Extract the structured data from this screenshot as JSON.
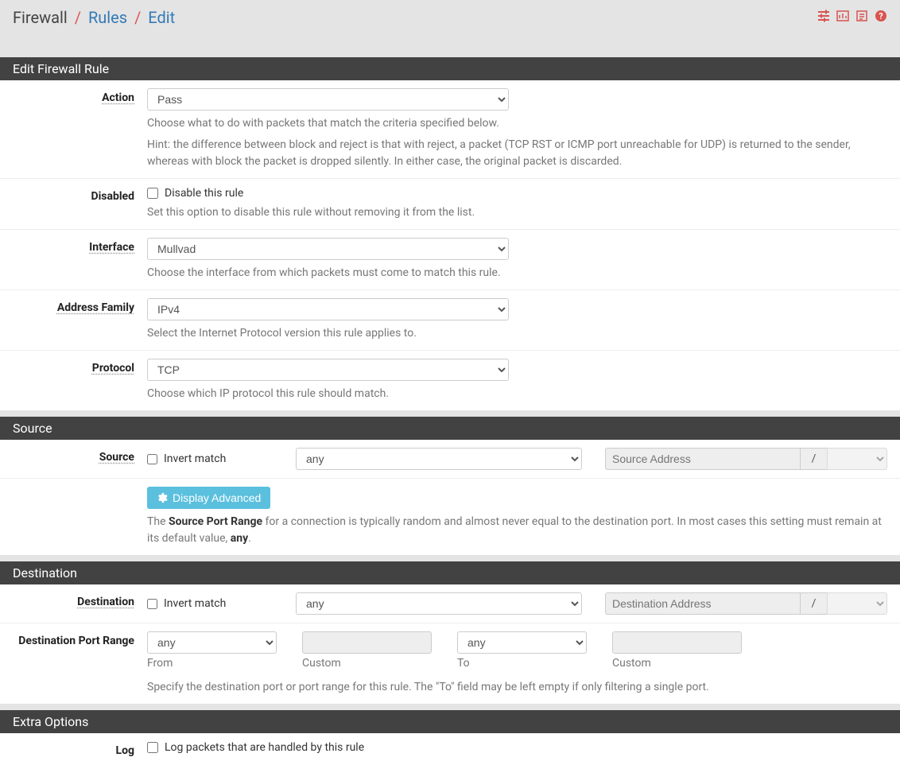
{
  "breadcrumb": {
    "firewall": "Firewall",
    "rules": "Rules",
    "edit": "Edit"
  },
  "panels": {
    "edit_rule": "Edit Firewall Rule",
    "source": "Source",
    "destination": "Destination",
    "extra": "Extra Options"
  },
  "action": {
    "label": "Action",
    "value": "Pass",
    "help1": "Choose what to do with packets that match the criteria specified below.",
    "help2": "Hint: the difference between block and reject is that with reject, a packet (TCP RST or ICMP port unreachable for UDP) is returned to the sender, whereas with block the packet is dropped silently. In either case, the original packet is discarded."
  },
  "disabled": {
    "label": "Disabled",
    "checkbox_label": "Disable this rule",
    "help": "Set this option to disable this rule without removing it from the list."
  },
  "interface": {
    "label": "Interface",
    "value": "Mullvad",
    "help": "Choose the interface from which packets must come to match this rule."
  },
  "address_family": {
    "label": "Address Family",
    "value": "IPv4",
    "help": "Select the Internet Protocol version this rule applies to."
  },
  "protocol": {
    "label": "Protocol",
    "value": "TCP",
    "help": "Choose which IP protocol this rule should match."
  },
  "source": {
    "label": "Source",
    "invert": "Invert match",
    "type": "any",
    "addr_placeholder": "Source Address",
    "slash": "/",
    "btn": "Display Advanced",
    "help_pre": "The ",
    "help_strong1": "Source Port Range",
    "help_mid": " for a connection is typically random and almost never equal to the destination port. In most cases this setting must remain at its default value, ",
    "help_strong2": "any",
    "help_post": "."
  },
  "destination": {
    "label": "Destination",
    "invert": "Invert match",
    "type": "any",
    "addr_placeholder": "Destination Address",
    "slash": "/",
    "port_label": "Destination Port Range",
    "from_sel": "any",
    "from_label": "From",
    "from_custom_label": "Custom",
    "to_sel": "any",
    "to_label": "To",
    "to_custom_label": "Custom",
    "help": "Specify the destination port or port range for this rule. The \"To\" field may be left empty if only filtering a single port."
  },
  "log": {
    "label": "Log",
    "checkbox_label": "Log packets that are handled by this rule"
  }
}
